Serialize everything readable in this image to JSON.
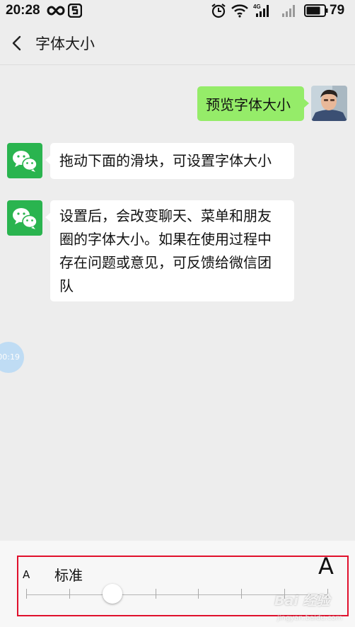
{
  "status_bar": {
    "time": "20:28",
    "battery": "79",
    "icons": [
      "infinity-icon",
      "app-icon",
      "alarm-icon",
      "wifi-icon",
      "signal-4g-icon",
      "signal-icon",
      "battery-icon"
    ]
  },
  "header": {
    "title": "字体大小",
    "back_icon": "chevron-left-icon"
  },
  "chat": {
    "sent_message": "预览字体大小",
    "received_messages": [
      "拖动下面的滑块，可设置字体大小",
      "设置后，会改变聊天、菜单和朋友圈的字体大小。如果在使用过程中存在问题或意见，可反馈给微信团队"
    ],
    "floating_time": "00:19"
  },
  "font_size_control": {
    "small_label": "A",
    "current_label": "标准",
    "large_label": "A",
    "levels": 8,
    "selected_index": 2
  },
  "watermark": {
    "text": "Bai 经验",
    "sub": "jingyan.baidu.com"
  },
  "colors": {
    "background": "#ededed",
    "sent_bubble": "#95ec69",
    "wechat_green": "#2ab44f",
    "highlight_border": "#e0102c"
  }
}
